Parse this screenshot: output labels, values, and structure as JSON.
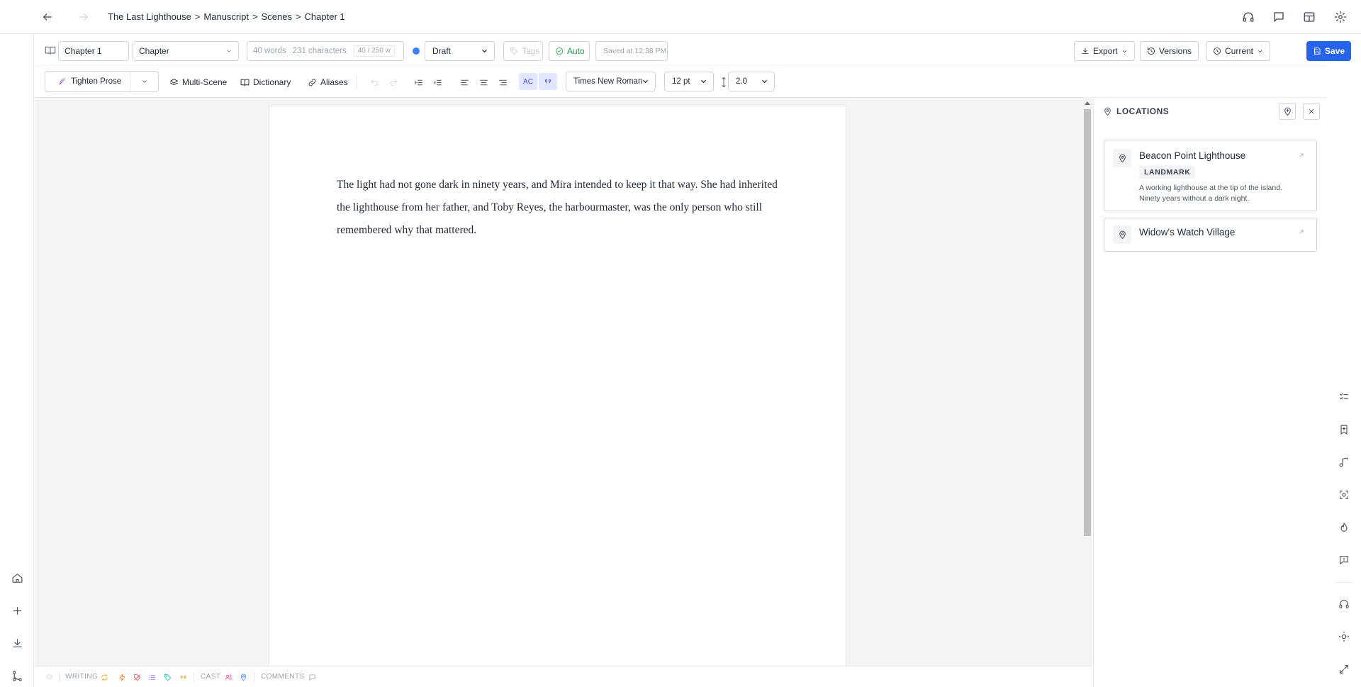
{
  "breadcrumb": {
    "items": [
      "The Last Lighthouse",
      "Manuscript",
      "Scenes",
      "Chapter 1"
    ],
    "separator": ">"
  },
  "toolbar": {
    "title_value": "Chapter 1",
    "type_select": "Chapter",
    "word_count": "40 words",
    "char_count": "231 characters",
    "goal_progress": "40 / 250 w",
    "status_color": "#3b82f6",
    "status_select": "Draft",
    "tags_placeholder": "Tags",
    "auto_label": "Auto",
    "saved_label": "Saved at 12:38 PM",
    "export_label": "Export",
    "versions_label": "Versions",
    "current_label": "Current",
    "save_label": "Save"
  },
  "format_toolbar": {
    "tighten_label": "Tighten Prose",
    "multiscene_label": "Multi-Scene",
    "dictionary_label": "Dictionary",
    "aliases_label": "Aliases",
    "autocorrect_label": "AC",
    "font_select": "Times New Roman",
    "size_select": "12 pt",
    "spacing_select": "2.0"
  },
  "document": {
    "paragraph": "The light had not gone dark in ninety years, and Mira intended to keep it that way. She had inherited the lighthouse from her father, and Toby Reyes, the harbourmaster, was the only person who still remembered why that mattered."
  },
  "locations_panel": {
    "title": "LOCATIONS",
    "items": [
      {
        "name": "Beacon Point Lighthouse",
        "badge": "LANDMARK",
        "description": "A working lighthouse at the tip of the island. Ninety years without a dark night."
      },
      {
        "name": "Widow's Watch Village"
      }
    ]
  },
  "status_bar": {
    "writing_label": "WRITING",
    "cast_label": "CAST",
    "comments_label": "COMMENTS"
  },
  "colors": {
    "accent": "#2563eb",
    "auto_green": "#16a34a",
    "status_orange": "#f59e0b",
    "status_red": "#ef4444",
    "status_purple": "#8b5cf6",
    "status_teal": "#14b8a6",
    "status_pink": "#ec4899"
  }
}
